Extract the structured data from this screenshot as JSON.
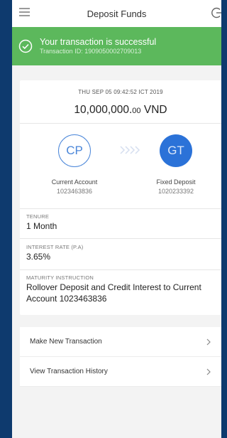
{
  "header": {
    "title": "Deposit Funds",
    "menu_icon": "menu-icon",
    "logout_icon": "logout-icon"
  },
  "banner": {
    "message": "Your transaction is successful",
    "transaction_id": "Transaction ID: 1909050002709013",
    "color": "#5cb85c",
    "icon": "check-circle-icon"
  },
  "receipt": {
    "datetime": "THU SEP 05 09:42:52 ICT 2019",
    "amount_whole": "10,000,000.",
    "amount_decimal": "00",
    "currency": "VND",
    "from": {
      "initials": "CP",
      "label": "Current Account",
      "number": "1023463836"
    },
    "to": {
      "initials": "GT",
      "label": "Fixed Deposit",
      "number": "1020233392"
    },
    "tenure": {
      "label": "TENURE",
      "value": "1 Month"
    },
    "interest": {
      "label": "INTEREST RATE (P.A)",
      "value": "3.65%"
    },
    "maturity": {
      "label": "MATURITY INSTRUCTION",
      "value": "Rollover Deposit and Credit Interest to Current Account 1023463836"
    }
  },
  "actions": [
    {
      "label": "Make New Transaction"
    },
    {
      "label": "View Transaction History"
    }
  ]
}
